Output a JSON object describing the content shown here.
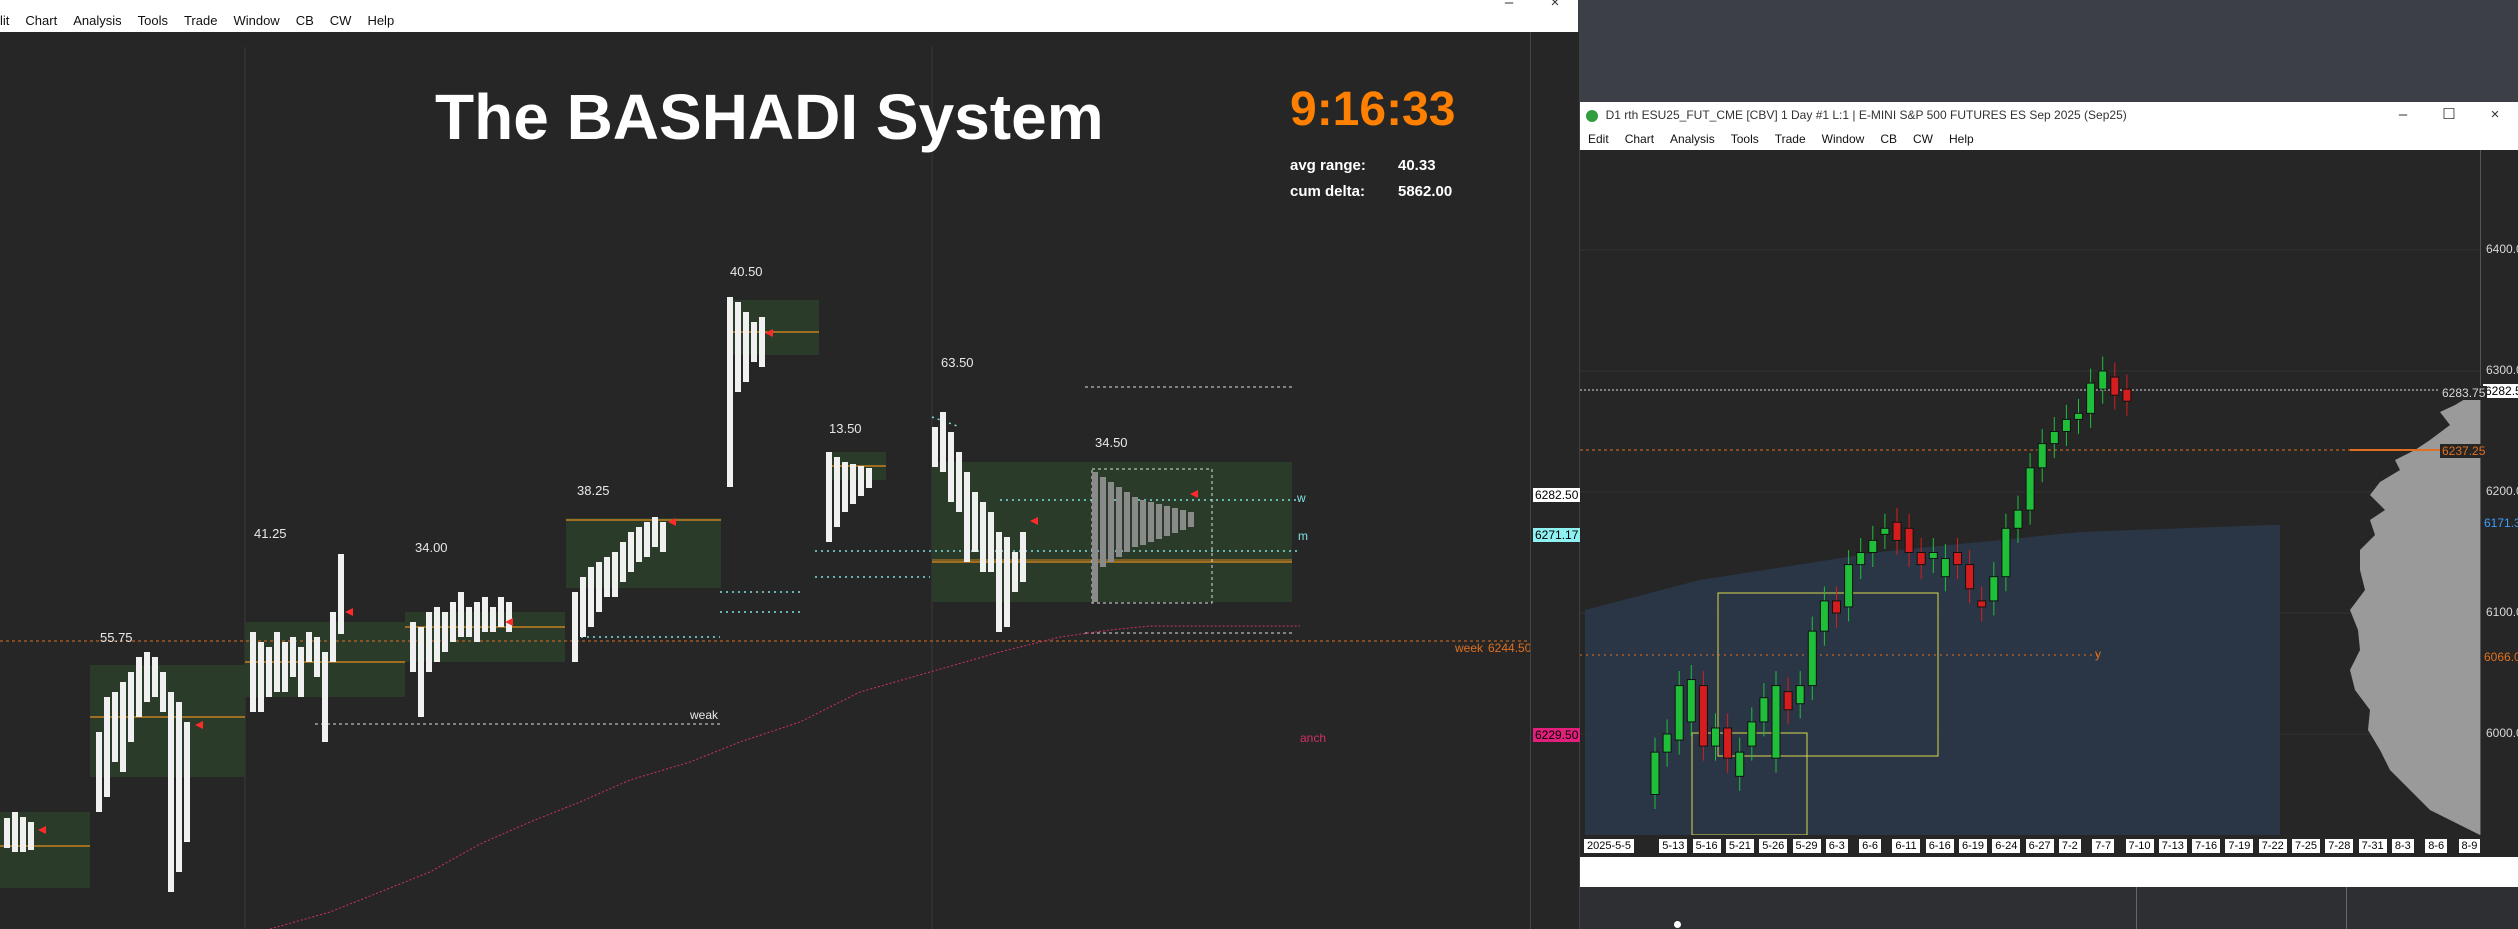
{
  "left_window": {
    "menu": [
      "Edit",
      "Chart",
      "Analysis",
      "Tools",
      "Trade",
      "Window",
      "CB",
      "CW",
      "Help"
    ],
    "menu_first_visible": "lit",
    "title_banner": "The BASHADI System",
    "clock": "9:16:33",
    "stats": [
      {
        "label": "avg range:",
        "value": "40.33"
      },
      {
        "label": "cum delta:",
        "value": "5862.00"
      }
    ],
    "range_labels": [
      "55.75",
      "41.25",
      "34.00",
      "38.25",
      "40.50",
      "13.50",
      "63.50",
      "34.50"
    ],
    "level_labels": {
      "week": "week",
      "week_value": "6244.50",
      "weak": "weak",
      "anch": "anch",
      "w": "w",
      "m": "m"
    },
    "price_tags": [
      "6282.50",
      "6271.17",
      "6229.50"
    ]
  },
  "right_window": {
    "title": "D1 rth ESU25_FUT_CME [CBV]  1 Day  #1 L:1 | E-MINI S&P 500 FUTURES ES Sep 2025 (Sep25)",
    "menu": [
      "Edit",
      "Chart",
      "Analysis",
      "Tools",
      "Trade",
      "Window",
      "CB",
      "CW",
      "Help"
    ],
    "y_ticks": [
      "6400.0",
      "6300.0",
      "6200.0",
      "6100.0",
      "6000.0"
    ],
    "price_tags": [
      "6283.75",
      "6282.5",
      "6237.25",
      "6171.3",
      "6066.0"
    ],
    "y_label": "y",
    "x_dates": [
      "2025-5-5",
      "5-13",
      "5-16",
      "5-21",
      "5-26",
      "5-29",
      "6-3",
      "6-6",
      "6-11",
      "6-16",
      "6-19",
      "6-24",
      "6-27",
      "7-2",
      "7-7",
      "7-10",
      "7-13",
      "7-16",
      "7-19",
      "7-22",
      "7-25",
      "7-28",
      "7-31",
      "8-3",
      "8-6",
      "8-9"
    ]
  },
  "colors": {
    "orange": "#ff8000",
    "chart_bg": "#262626",
    "candle_up": "#1fbf3a",
    "candle_down": "#d61d1d",
    "value_area": "#2b3d2b"
  },
  "chart_data": {
    "type": "candlestick",
    "x": [
      "5-12",
      "5-13",
      "5-14",
      "5-15",
      "5-16",
      "5-19",
      "5-20",
      "5-21",
      "5-22",
      "5-23",
      "5-26",
      "5-27",
      "5-28",
      "5-29",
      "6-2",
      "6-3",
      "6-4",
      "6-5",
      "6-6",
      "6-9",
      "6-10",
      "6-11",
      "6-12",
      "6-13",
      "6-16",
      "6-17",
      "6-18",
      "6-19",
      "6-20",
      "6-23",
      "6-24",
      "6-25",
      "6-26",
      "6-27",
      "6-30",
      "7-1",
      "7-2",
      "7-3",
      "7-7",
      "7-8"
    ],
    "open": [
      5950,
      5985,
      5995,
      6010,
      6040,
      5990,
      6005,
      5965,
      5990,
      6010,
      5980,
      6035,
      6025,
      6040,
      6085,
      6110,
      6105,
      6140,
      6150,
      6165,
      6175,
      6170,
      6150,
      6145,
      6130,
      6150,
      6140,
      6110,
      6110,
      6130,
      6170,
      6185,
      6220,
      6240,
      6250,
      6260,
      6265,
      6285,
      6295,
      6285
    ],
    "close": [
      5985,
      6000,
      6040,
      6045,
      5990,
      6005,
      5980,
      5985,
      6010,
      6030,
      6040,
      6020,
      6040,
      6085,
      6110,
      6100,
      6140,
      6150,
      6160,
      6170,
      6160,
      6150,
      6140,
      6150,
      6145,
      6140,
      6120,
      6105,
      6130,
      6170,
      6185,
      6220,
      6240,
      6250,
      6260,
      6265,
      6290,
      6300,
      6280,
      6275
    ]
  }
}
